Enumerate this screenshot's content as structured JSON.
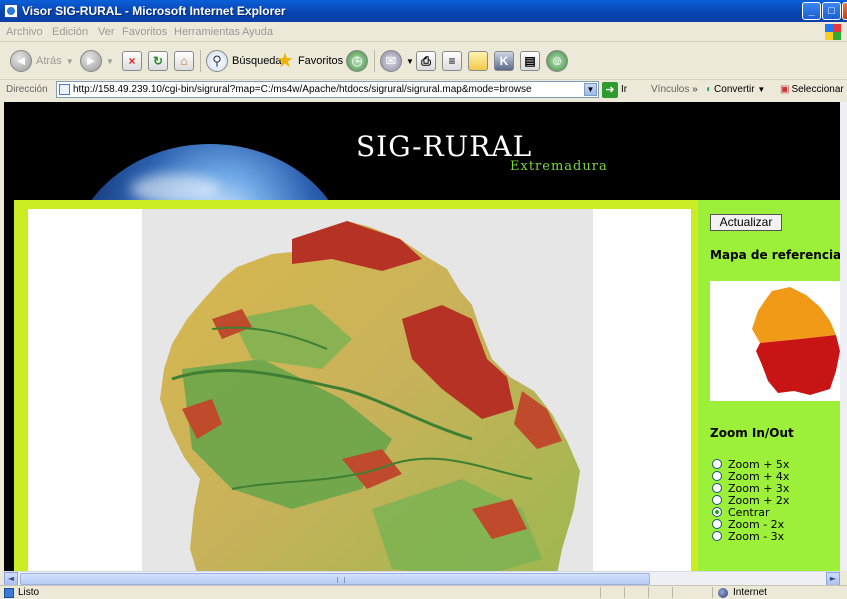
{
  "window": {
    "title": "Visor SIG-RURAL - Microsoft Internet Explorer",
    "minimize_glyph": "_",
    "maximize_glyph": "□",
    "close_glyph": "X"
  },
  "menu": [
    "Archivo",
    "Edición",
    "Ver",
    "Favoritos",
    "Herramientas",
    "Ayuda"
  ],
  "toolbar": {
    "back_label": "Atrás",
    "search_label": "Búsqueda",
    "favorites_label": "Favoritos"
  },
  "address": {
    "label": "Dirección",
    "url": "http://158.49.239.10/cgi-bin/sigrural?map=C:/ms4w/Apache/htdocs/sigrural/sigrural.map&mode=browse",
    "go_label": "Ir",
    "links_label": "Vínculos",
    "links_chevron": "»",
    "convert_label": "Convertir",
    "select_label": "Seleccionar"
  },
  "page": {
    "site_title": "SIG-RURAL",
    "site_subtitle": "Extremadura",
    "update_button": "Actualizar",
    "reference_map_title": "Mapa de referencia:",
    "zoom_title": "Zoom In/Out",
    "zoom_options": [
      {
        "label": "Zoom + 5x",
        "selected": false
      },
      {
        "label": "Zoom + 4x",
        "selected": false
      },
      {
        "label": "Zoom + 3x",
        "selected": false
      },
      {
        "label": "Zoom + 2x",
        "selected": false
      },
      {
        "label": "Centrar",
        "selected": true
      },
      {
        "label": "Zoom - 2x",
        "selected": false
      },
      {
        "label": "Zoom - 3x",
        "selected": false
      }
    ]
  },
  "status": {
    "text": "Listo",
    "zone": "Internet"
  },
  "colors": {
    "frame": "#c9ed22",
    "side_panel": "#9cf03a",
    "map_bg": "#e6e6e6",
    "terrain_low": "#4f9a3a",
    "terrain_mid": "#e3c35a",
    "terrain_high": "#b53225",
    "ref_north": "#f09a18",
    "ref_south": "#c81414"
  }
}
